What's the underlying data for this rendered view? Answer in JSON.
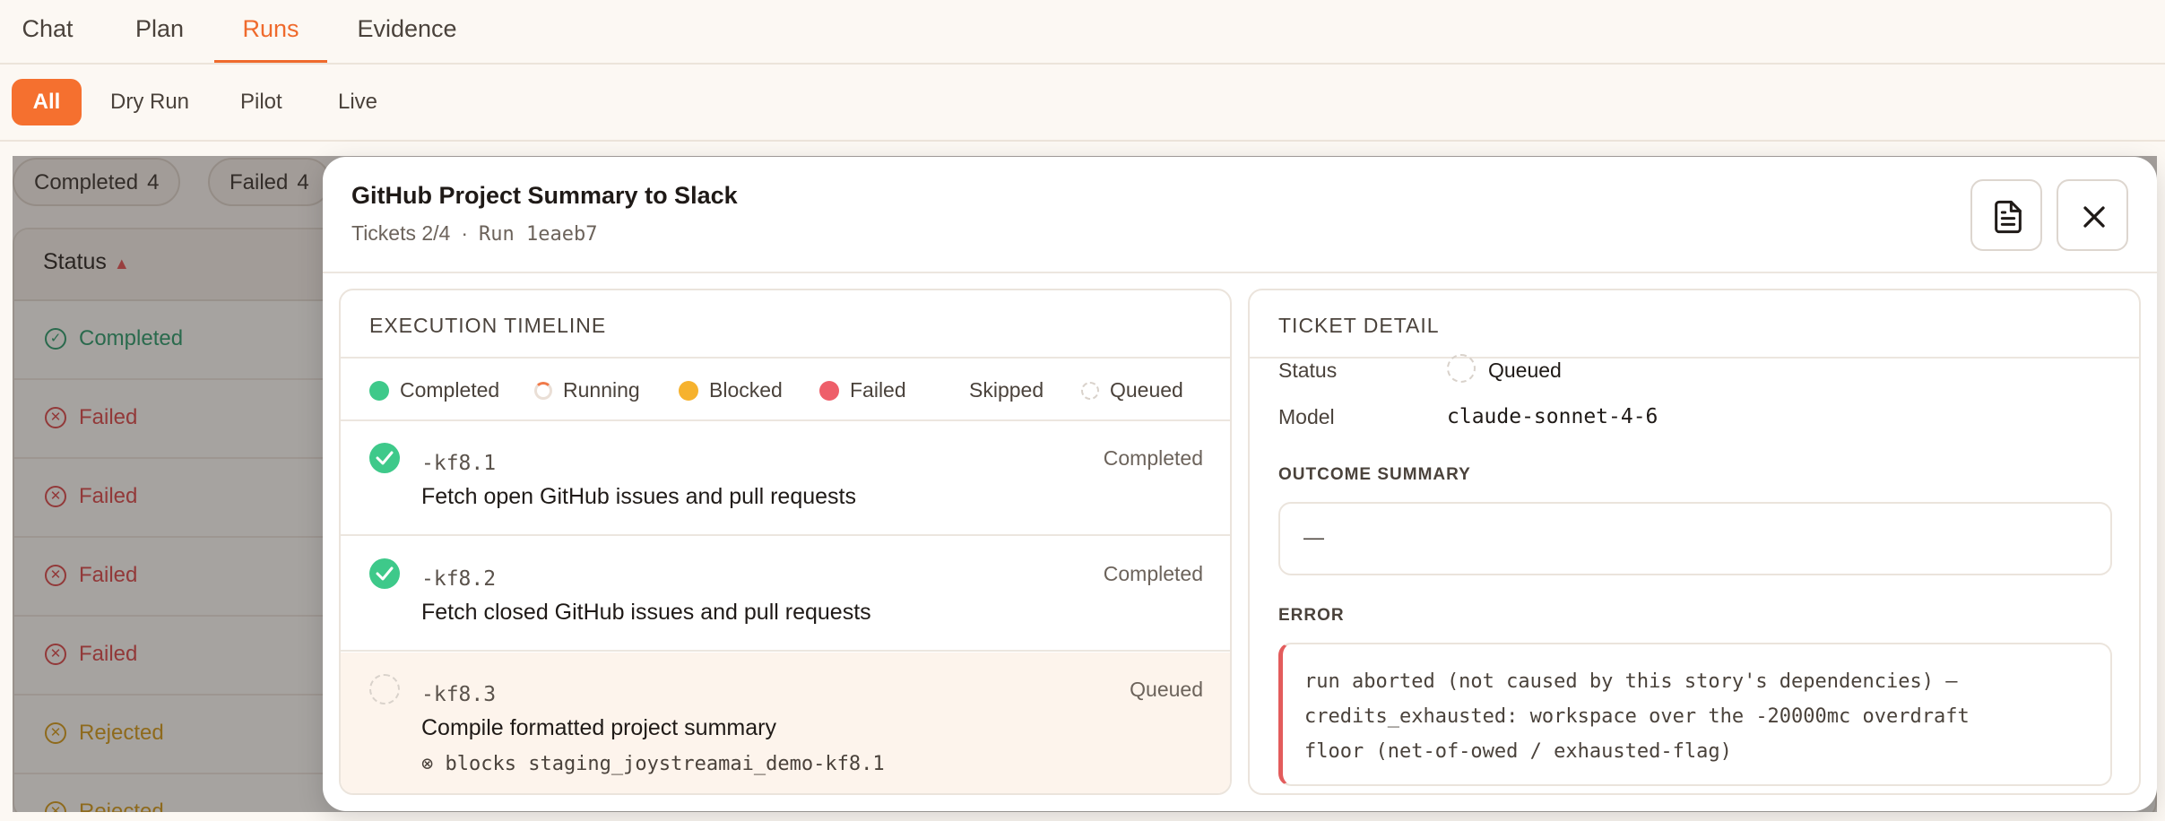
{
  "top_tabs": [
    {
      "label": "Chat"
    },
    {
      "label": "Plan"
    },
    {
      "label": "Runs"
    },
    {
      "label": "Evidence"
    }
  ],
  "filters": [
    {
      "label": "All"
    },
    {
      "label": "Dry Run"
    },
    {
      "label": "Pilot"
    },
    {
      "label": "Live"
    }
  ],
  "background": {
    "chips": [
      {
        "label": "Completed",
        "count": "4"
      },
      {
        "label": "Failed",
        "count": "4"
      }
    ],
    "status_header": "Status",
    "rows": [
      {
        "status": "Completed"
      },
      {
        "status": "Failed"
      },
      {
        "status": "Failed"
      },
      {
        "status": "Failed"
      },
      {
        "status": "Failed"
      },
      {
        "status": "Rejected"
      },
      {
        "status": "Rejected"
      }
    ]
  },
  "modal": {
    "title": "GitHub Project Summary to Slack",
    "tickets": "Tickets 2/4",
    "run": "Run 1eaeb7",
    "timeline": {
      "title": "EXECUTION TIMELINE",
      "legend": [
        {
          "label": "Completed",
          "color": "#3ec98a"
        },
        {
          "label": "Running",
          "color": "#f07a4a"
        },
        {
          "label": "Blocked",
          "color": "#f6b22e"
        },
        {
          "label": "Failed",
          "color": "#ee5f6a"
        },
        {
          "label": "Skipped"
        },
        {
          "label": "Queued"
        }
      ],
      "tickets": [
        {
          "id": "-kf8.1",
          "title": "Fetch open GitHub issues and pull requests",
          "status": "Completed"
        },
        {
          "id": "-kf8.2",
          "title": "Fetch closed GitHub issues and pull requests",
          "status": "Completed"
        },
        {
          "id": "-kf8.3",
          "title": "Compile formatted project summary",
          "status": "Queued",
          "blocks": "⊗ blocks staging_joystreamai_demo-kf8.1"
        }
      ]
    },
    "detail": {
      "title": "TICKET DETAIL",
      "status_label": "Status",
      "status_value": "Queued",
      "model_label": "Model",
      "model_value": "claude-sonnet-4-6",
      "outcome_title": "OUTCOME SUMMARY",
      "outcome_value": "—",
      "error_title": "ERROR",
      "error_lines": [
        "run aborted (not caused by this story's dependencies) —",
        "credits_exhausted: workspace over the -20000mc overdraft",
        "floor (net-of-owed / exhausted-flag)"
      ]
    }
  }
}
